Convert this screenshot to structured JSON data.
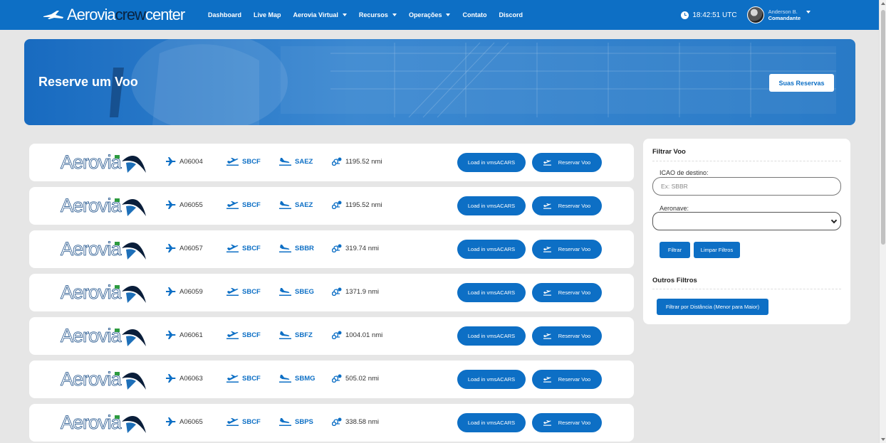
{
  "navbar": {
    "brand_light": "Aerovia",
    "brand_dark": "crew",
    "brand_tail": "center",
    "links": [
      {
        "label": "Dashboard",
        "dropdown": false
      },
      {
        "label": "Live Map",
        "dropdown": false
      },
      {
        "label": "Aerovia Virtual",
        "dropdown": true
      },
      {
        "label": "Recursos",
        "dropdown": true
      },
      {
        "label": "Operações",
        "dropdown": true
      },
      {
        "label": "Contato",
        "dropdown": false
      },
      {
        "label": "Discord",
        "dropdown": false
      }
    ],
    "time": "18:42:51 UTC",
    "user_name": "Anderson B.",
    "user_role": "Comandante"
  },
  "hero": {
    "title": "Reserve um Voo",
    "reservations_button": "Suas Reservas"
  },
  "airline_logo_text": "Aerovia",
  "load_button_label": "Load in vmsACARS",
  "reserve_button_label": "Reservar Voo",
  "flights": [
    {
      "flight": "A06004",
      "dep": "SBCF",
      "arr": "SAEZ",
      "distance": "1195.52 nmi"
    },
    {
      "flight": "A06055",
      "dep": "SBCF",
      "arr": "SAEZ",
      "distance": "1195.52 nmi"
    },
    {
      "flight": "A06057",
      "dep": "SBCF",
      "arr": "SBBR",
      "distance": "319.74 nmi"
    },
    {
      "flight": "A06059",
      "dep": "SBCF",
      "arr": "SBEG",
      "distance": "1371.9 nmi"
    },
    {
      "flight": "A06061",
      "dep": "SBCF",
      "arr": "SBFZ",
      "distance": "1004.01 nmi"
    },
    {
      "flight": "A06063",
      "dep": "SBCF",
      "arr": "SBMG",
      "distance": "505.02 nmi"
    },
    {
      "flight": "A06065",
      "dep": "SBCF",
      "arr": "SBPS",
      "distance": "338.58 nmi"
    }
  ],
  "filter": {
    "title": "Filtrar Voo",
    "icao_label": "ICAO de destino:",
    "icao_placeholder": "Ex: SBBR",
    "aircraft_label": "Aeronave:",
    "aircraft_value": "",
    "filter_button": "Filtrar",
    "clear_button": "Limpar Filtros",
    "other_title": "Outros Filtros",
    "distance_button": "Filtrar por Distância (Menor para Maior)"
  },
  "colors": {
    "primary": "#0d6fc5",
    "page_bg": "#e6e6e6",
    "card_bg": "#ffffff"
  }
}
